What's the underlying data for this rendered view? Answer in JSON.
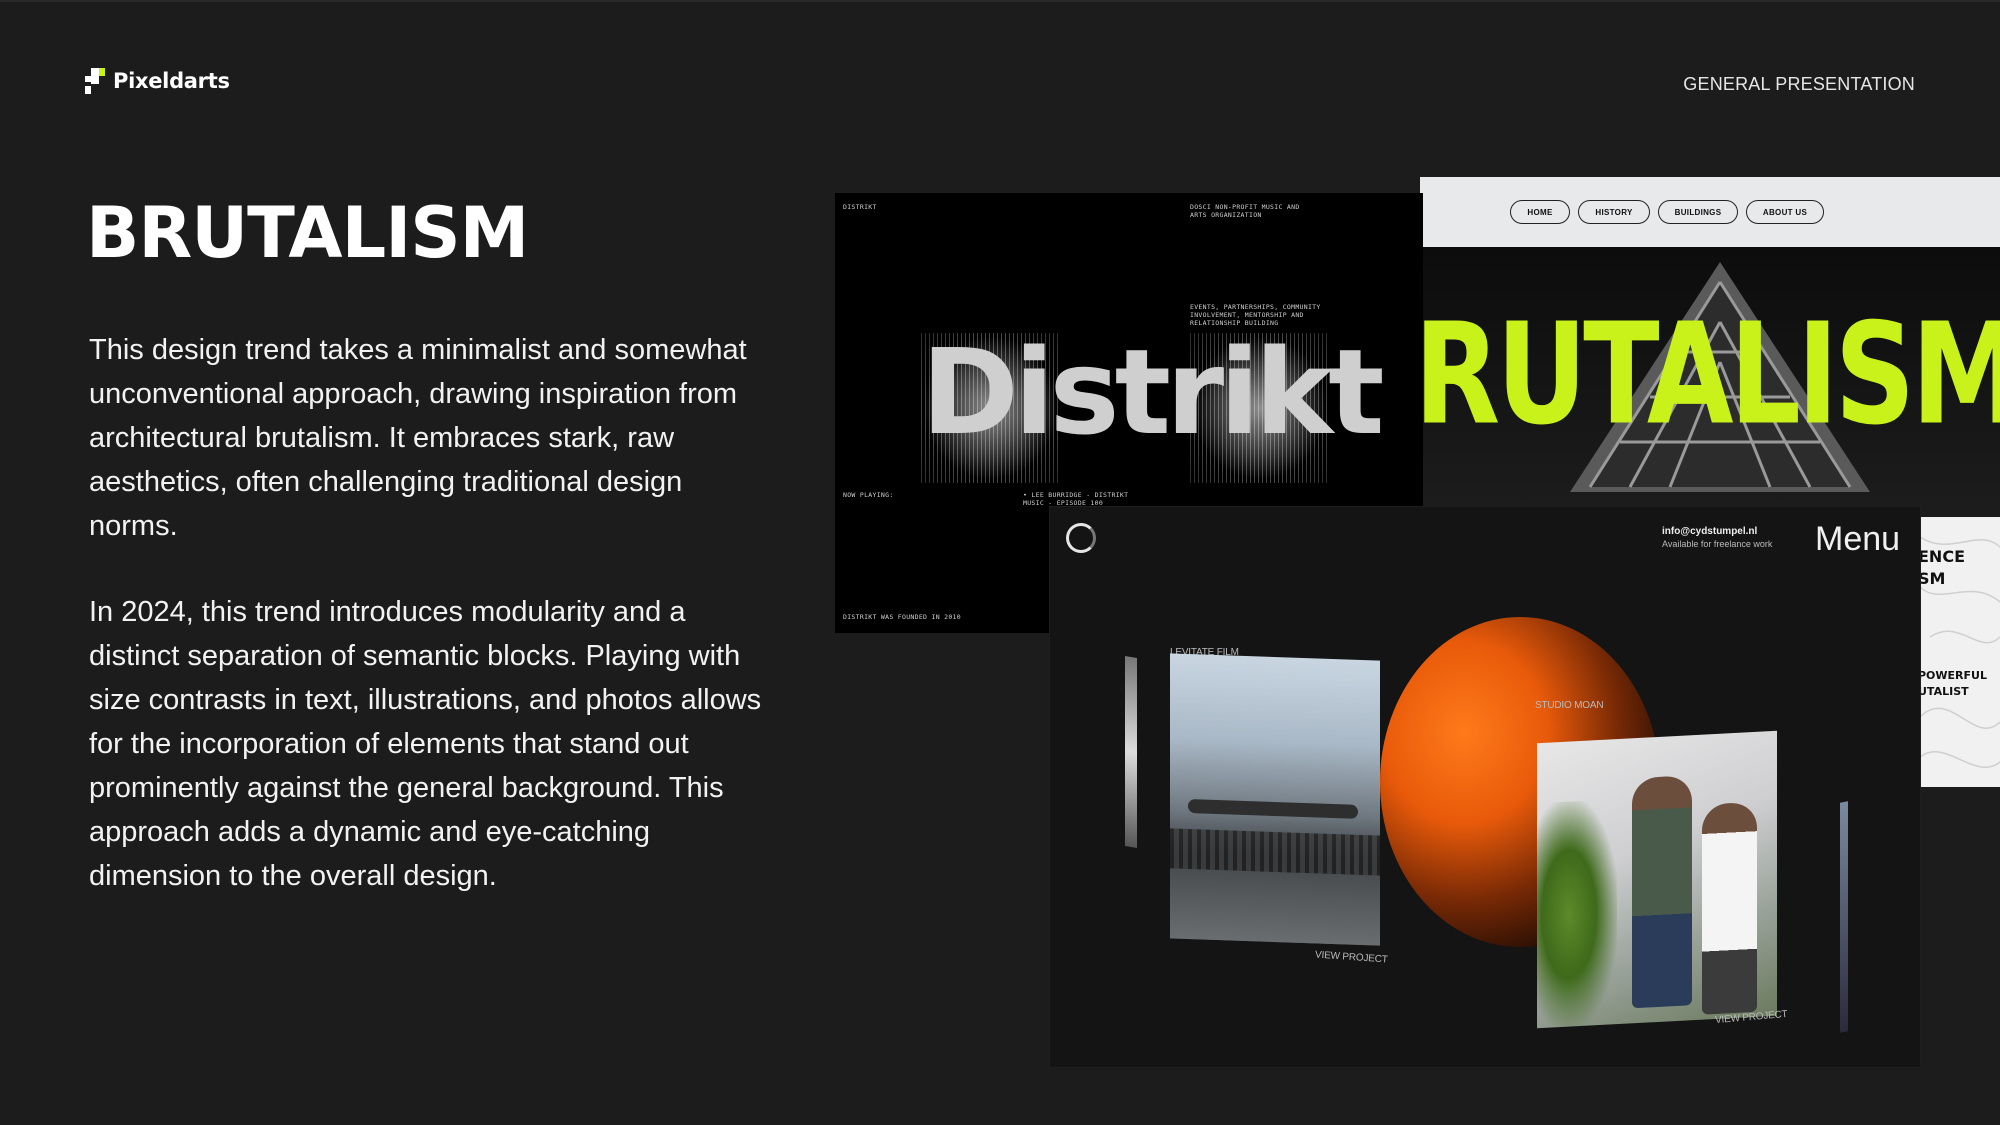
{
  "header": {
    "brand": "Pixeldarts",
    "deck_label": "GENERAL PRESENTATION"
  },
  "main": {
    "title": "BRUTALISM",
    "paragraph_1": " This design trend takes a minimalist and somewhat unconventional approach, drawing inspiration from architectural brutalism. It embraces stark, raw aesthetics, often challenging traditional design norms.",
    "paragraph_2": "In 2024, this trend introduces modularity and a distinct separation of semantic blocks. Playing with size contrasts in text, illustrations, and photos allows for the incorporation of elements that stand out prominently against the general background. This approach adds a dynamic and eye-catching dimension to the overall design."
  },
  "collage": {
    "distrikt": {
      "corner_label": "DISTRIKT",
      "blurb": "DOSCI NON-PROFIT MUSIC AND ARTS ORGANIZATION",
      "events": "EVENTS, PARTNERSHIPS, COMMUNITY INVOLVEMENT, MENTORSHIP AND RELATIONSHIP BUILDING",
      "headline": "Distrikt",
      "now_playing": "NOW PLAYING:",
      "track": "• LEE BURRIDGE - DISTRIKT MUSIC - EPISODE 100",
      "founded": "DISTRIKT WAS FOUNDED IN 2010"
    },
    "brutalism_site": {
      "nav": [
        "HOME",
        "HISTORY",
        "BUILDINGS",
        "ABOUT US"
      ],
      "headline": "RUTALISM"
    },
    "topo": {
      "line_1": "ENCE",
      "line_2": "SM",
      "line_3": "POWERFUL",
      "line_4": "UTALIST"
    },
    "studio": {
      "email": "info@cydstumpel.nl",
      "availability": "Available for freelance work",
      "menu": "Menu",
      "card_1_title": "LEVITATE FILM",
      "card_1_cta": "VIEW PROJECT",
      "card_2_title": "STUDIO MOAN",
      "card_2_cta": "VIEW PROJECT"
    }
  },
  "colors": {
    "background": "#1c1c1d",
    "accent_green": "#c8f21a",
    "accent_orange": "#ff7a1a"
  }
}
